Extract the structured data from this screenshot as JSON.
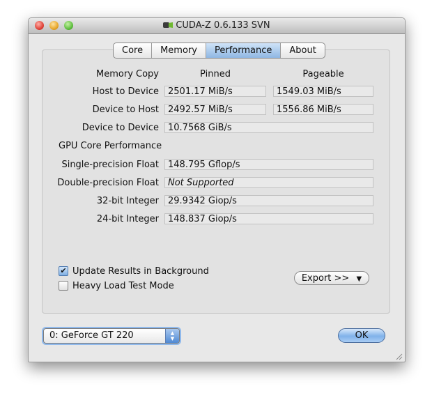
{
  "window": {
    "title": "CUDA-Z 0.6.133 SVN",
    "app_icon": "cuda-z-icon"
  },
  "tabs": [
    {
      "label": "Core"
    },
    {
      "label": "Memory"
    },
    {
      "label": "Performance",
      "active": true
    },
    {
      "label": "About"
    }
  ],
  "memory_copy": {
    "section_label": "Memory Copy",
    "pinned_header": "Pinned",
    "pageable_header": "Pageable",
    "rows": [
      {
        "label": "Host to Device",
        "pinned": "2501.17 MiB/s",
        "pageable": "1549.03 MiB/s"
      },
      {
        "label": "Device to Host",
        "pinned": "2492.57 MiB/s",
        "pageable": "1556.86 MiB/s"
      },
      {
        "label": "Device to Device",
        "value": "10.7568 GiB/s"
      }
    ]
  },
  "gpu_core": {
    "section_label": "GPU Core Performance",
    "rows": [
      {
        "label": "Single-precision Float",
        "value": "148.795 Gflop/s"
      },
      {
        "label": "Double-precision Float",
        "value": "Not Supported"
      },
      {
        "label": "32-bit Integer",
        "value": "29.9342 Giop/s"
      },
      {
        "label": "24-bit Integer",
        "value": "148.837 Giop/s"
      }
    ]
  },
  "options": {
    "update_background": {
      "label": "Update Results in Background",
      "checked": true
    },
    "heavy_load": {
      "label": "Heavy Load Test Mode",
      "checked": false
    }
  },
  "export_button": {
    "label": "Export >>",
    "icon": "triangle-down-icon"
  },
  "device_select": {
    "value": "0: GeForce GT 220"
  },
  "ok_button": {
    "label": "OK"
  },
  "colors": {
    "accent_blue": "#8fb7e3",
    "window_bg": "#e8e8e8",
    "field_bg": "#e9e9e9"
  }
}
